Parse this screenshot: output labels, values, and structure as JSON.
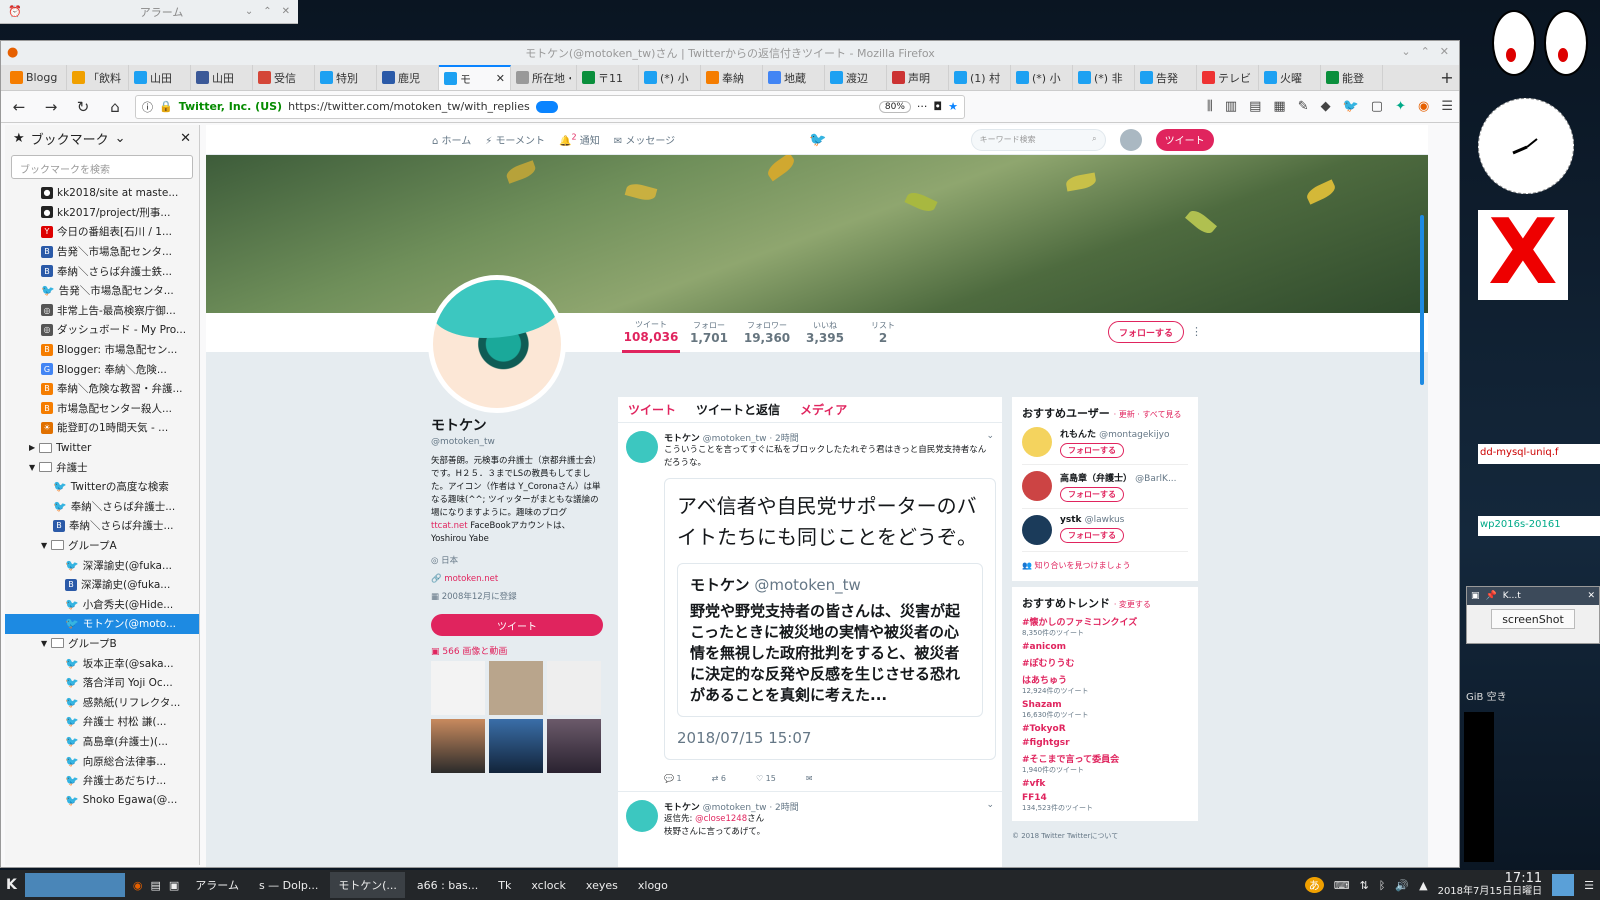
{
  "alarm_window": {
    "title": "アラーム"
  },
  "firefox": {
    "window_title": "モトケン(@motoken_tw)さん | Twitterからの返信付きツイート - Mozilla Firefox",
    "tabs": [
      {
        "label": "Blogg",
        "icon": "blogger-icon",
        "color": "#f57d00"
      },
      {
        "label": "「飲料",
        "icon": "sun-icon",
        "color": "#f0a000"
      },
      {
        "label": "山田",
        "icon": "twitter-icon",
        "color": "#1da1f2"
      },
      {
        "label": "山田",
        "icon": "facebook-icon",
        "color": "#3b5998"
      },
      {
        "label": "受信",
        "icon": "gmail-icon",
        "color": "#d44638"
      },
      {
        "label": "特別",
        "icon": "twitter-icon",
        "color": "#1da1f2"
      },
      {
        "label": "鹿児",
        "icon": "bookmark-icon",
        "color": "#2b5aa8"
      },
      {
        "label": "モ",
        "icon": "twitter-icon",
        "color": "#1da1f2"
      },
      {
        "label": "所在地・",
        "icon": "none",
        "color": "#999"
      },
      {
        "label": "〒11",
        "icon": "map-icon",
        "color": "#0a8f3c"
      },
      {
        "label": "(*) 小",
        "icon": "twitter-icon",
        "color": "#1da1f2"
      },
      {
        "label": "奉納",
        "icon": "blogger-icon",
        "color": "#f57d00"
      },
      {
        "label": "地蔵",
        "icon": "google-icon",
        "color": "#4285f4"
      },
      {
        "label": "渡辺",
        "icon": "twitter-icon",
        "color": "#1da1f2"
      },
      {
        "label": "声明",
        "icon": "doc-icon",
        "color": "#c33"
      },
      {
        "label": "(1) 村",
        "icon": "twitter-icon",
        "color": "#1da1f2"
      },
      {
        "label": "(*) 小",
        "icon": "twitter-icon",
        "color": "#1da1f2"
      },
      {
        "label": "(*) 非",
        "icon": "twitter-icon",
        "color": "#1da1f2"
      },
      {
        "label": "告発",
        "icon": "twitter-icon",
        "color": "#1da1f2"
      },
      {
        "label": "テレビ",
        "icon": "tv-icon",
        "color": "#e33"
      },
      {
        "label": "火曜",
        "icon": "twitter-icon",
        "color": "#1da1f2"
      },
      {
        "label": "能登",
        "icon": "map-icon",
        "color": "#0a8f3c"
      }
    ],
    "active_tab": 7,
    "url_identity": "Twitter, Inc. (US)",
    "url": "https://twitter.com/motoken_tw/with_replies",
    "zoom": "80%"
  },
  "sidebar": {
    "title": "ブックマーク",
    "search_placeholder": "ブックマークを検索",
    "items": [
      {
        "label": "kk2018/site at maste...",
        "icon": "github-icon",
        "indent": 3
      },
      {
        "label": "kk2017/project/刑事...",
        "icon": "github-icon",
        "indent": 3
      },
      {
        "label": "今日の番組表[石川 / 1...",
        "icon": "yahoo-icon",
        "indent": 3
      },
      {
        "label": "告発＼市場急配センタ...",
        "icon": "blog-icon",
        "indent": 3
      },
      {
        "label": "奉納＼さらば弁護士鉄...",
        "icon": "blog-icon",
        "indent": 3
      },
      {
        "label": "告発＼市場急配センタ...",
        "icon": "twitter-icon",
        "indent": 3
      },
      {
        "label": "非常上告-最高検察庁御...",
        "icon": "globe-icon",
        "indent": 3
      },
      {
        "label": "ダッシュボード - My Pro...",
        "icon": "globe-icon",
        "indent": 3
      },
      {
        "label": "Blogger: 市場急配セン...",
        "icon": "blogger-icon",
        "indent": 3
      },
      {
        "label": "Blogger: 奉納＼危険...",
        "icon": "google-icon",
        "indent": 3
      },
      {
        "label": "奉納＼危険な教習・弁護...",
        "icon": "blogger-icon",
        "indent": 3
      },
      {
        "label": "市場急配センター殺人...",
        "icon": "blogger-icon",
        "indent": 3
      },
      {
        "label": "能登町の1時間天気 - ...",
        "icon": "weather-icon",
        "indent": 3
      },
      {
        "label": "Twitter",
        "icon": "folder-icon",
        "indent": 2,
        "expander": "▶"
      },
      {
        "label": "弁護士",
        "icon": "folder-icon",
        "indent": 2,
        "expander": "▼"
      },
      {
        "label": "Twitterの高度な検索",
        "icon": "twitter-icon",
        "indent": 4
      },
      {
        "label": "奉納＼さらば弁護士...",
        "icon": "twitter-icon",
        "indent": 4
      },
      {
        "label": "奉納＼さらば弁護士...",
        "icon": "blog-icon",
        "indent": 4
      },
      {
        "label": "グループA",
        "icon": "folder-icon",
        "indent": 3,
        "expander": "▼"
      },
      {
        "label": "深澤諭史(@fuka...",
        "icon": "twitter-icon",
        "indent": 5
      },
      {
        "label": "深澤諭史(@fuka...",
        "icon": "blog-icon",
        "indent": 5
      },
      {
        "label": "小倉秀夫(@Hide...",
        "icon": "twitter-icon",
        "indent": 5
      },
      {
        "label": "モトケン(@moto...",
        "icon": "twitter-icon",
        "indent": 5,
        "selected": true
      },
      {
        "label": "グループB",
        "icon": "folder-icon",
        "indent": 3,
        "expander": "▼"
      },
      {
        "label": "坂本正幸(@saka...",
        "icon": "twitter-icon",
        "indent": 5
      },
      {
        "label": "落合洋司 Yoji Oc...",
        "icon": "twitter-icon",
        "indent": 5
      },
      {
        "label": "感熱紙(リフレクタ...",
        "icon": "twitter-icon",
        "indent": 5
      },
      {
        "label": "弁護士 村松 謙(...",
        "icon": "twitter-icon",
        "indent": 5
      },
      {
        "label": "高島章(弁護士)(...",
        "icon": "twitter-icon",
        "indent": 5
      },
      {
        "label": "向原総合法律事...",
        "icon": "twitter-icon",
        "indent": 5
      },
      {
        "label": "弁護士あだちけ...",
        "icon": "twitter-icon",
        "indent": 5
      },
      {
        "label": "Shoko Egawa(@...",
        "icon": "twitter-icon",
        "indent": 5
      }
    ]
  },
  "twitter": {
    "nav": {
      "home": "ホーム",
      "moments": "モーメント",
      "notifications": "通知",
      "notif_badge": "2",
      "messages": "メッセージ",
      "search_placeholder": "キーワード検索",
      "tweet_button": "ツイート"
    },
    "stats": [
      {
        "key": "ツイート",
        "value": "108,036"
      },
      {
        "key": "フォロー",
        "value": "1,701"
      },
      {
        "key": "フォロワー",
        "value": "19,360"
      },
      {
        "key": "いいね",
        "value": "3,395"
      },
      {
        "key": "リスト",
        "value": "2"
      }
    ],
    "follow_button": "フォローする",
    "profile": {
      "name": "モトケン",
      "handle": "@motoken_tw",
      "bio": "矢部善朗。元検事の弁護士（京都弁護士会）です。H２５．３までLSの教員もしてました。アイコン（作者は Y_Coronaさん）は単なる趣味(^^; ツイッターがまともな議論の場になりますように。趣味のブログ",
      "bio_link": "ttcat.net",
      "bio_tail": "FaceBookアカウントは、Yoshirou Yabe",
      "location": "日本",
      "website": "motoken.net",
      "joined": "2008年12月に登録",
      "tweet_button": "ツイート",
      "media_label": "566 画像と動画"
    },
    "timeline": {
      "tabs": [
        "ツイート",
        "ツイートと返信",
        "メディア"
      ],
      "tweet1": {
        "name": "モトケン",
        "handle": "@motoken_tw",
        "time": "· 2時間",
        "text": "こういうことを言ってすぐに私をブロックしたたれぞう君はきっと自民党支持者なんだろうな。",
        "quote_big": "アベ信者や自民党サポーターのバイトたちにも同じことをどうぞ。",
        "inner_name": "モトケン",
        "inner_handle": "@motoken_tw",
        "inner_text": "野党や野党支持者の皆さんは、災害が起こったときに被災地の実情や被災者の心情を無視した政府批判をすると、被災者に決定的な反発や反感を生じさせる恐れがあることを真剣に考えた...",
        "date": "2018/07/15 15:07",
        "replies": "1",
        "retweets": "6",
        "likes": "15"
      },
      "tweet2": {
        "name": "モトケン",
        "handle": "@motoken_tw",
        "time": "· 2時間",
        "reply_prefix": "返信先:",
        "reply_to": "@close1248",
        "reply_suffix": "さん",
        "text": "枝野さんに言ってあげて。"
      }
    },
    "suggest": {
      "title": "おすすめユーザー",
      "links": "· 更新 · すべて見る",
      "users": [
        {
          "name": "れもんた",
          "handle": "@montagekijyo",
          "color": "#f4d35e"
        },
        {
          "name": "高島章（弁護士）",
          "handle": "@BarlK...",
          "color": "#c44"
        },
        {
          "name": "ystk",
          "handle": "@lawkus",
          "color": "#1b3b5a"
        }
      ],
      "follow_label": "フォローする",
      "find": "知り合いを見つけましょう"
    },
    "trends": {
      "title": "おすすめトレンド",
      "change": "· 変更する",
      "items": [
        {
          "name": "#懐かしのファミコンクイズ",
          "count": "8,350件のツイート"
        },
        {
          "name": "#anicom",
          "count": ""
        },
        {
          "name": "#ぽむりうむ",
          "count": ""
        },
        {
          "name": "はあちゅう",
          "count": "12,924件のツイート"
        },
        {
          "name": "Shazam",
          "count": "16,630件のツイート"
        },
        {
          "name": "#TokyoR",
          "count": ""
        },
        {
          "name": "#fightgsr",
          "count": ""
        },
        {
          "name": "#そこまで言って委員会",
          "count": "1,940件のツイート"
        },
        {
          "name": "#vfk",
          "count": ""
        },
        {
          "name": "FF14",
          "count": "134,523件のツイート"
        }
      ],
      "copyright": "© 2018 Twitter  Twitterについて"
    }
  },
  "right_desk": {
    "tk_title": "K...t",
    "tk_button": "screenShot",
    "free": "GiB 空き",
    "mysql": "dd-mysql-uniq.f",
    "wp": "wp2016s-20161"
  },
  "taskbar": {
    "items": [
      {
        "label": "アラーム"
      },
      {
        "label": "s — Dolp..."
      },
      {
        "label": "モトケン(..."
      },
      {
        "label": "a66 : bas..."
      },
      {
        "label": "Tk"
      },
      {
        "label": "xclock"
      },
      {
        "label": "xeyes"
      },
      {
        "label": "xlogo"
      }
    ],
    "time": "17:11",
    "date": "2018年7月15日日曜日"
  }
}
